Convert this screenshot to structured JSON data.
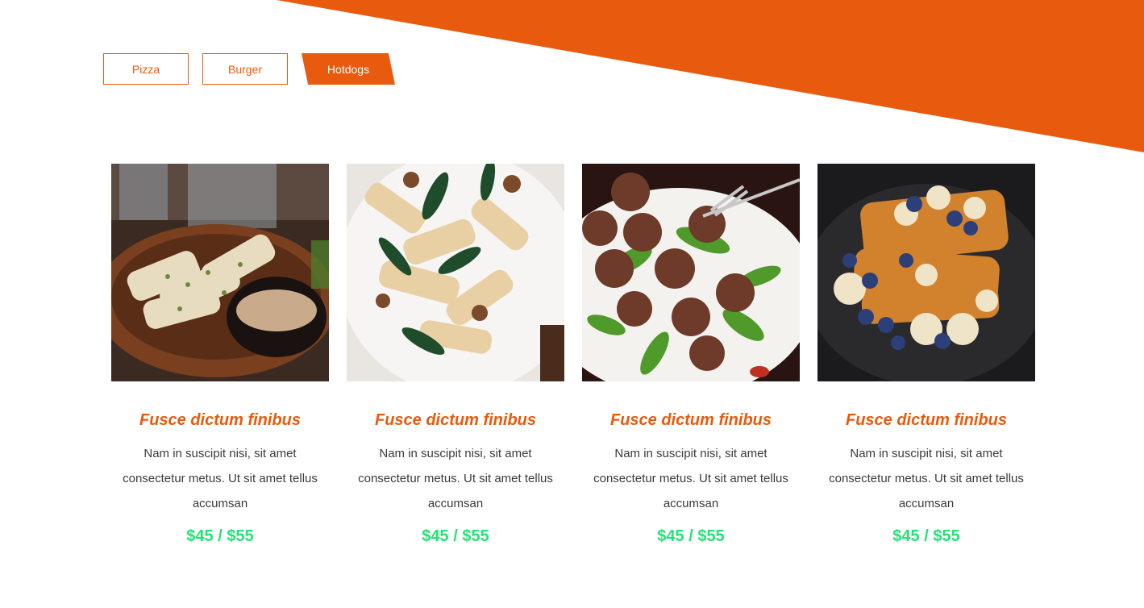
{
  "colors": {
    "accent": "#E85A0E",
    "price": "#22E374",
    "text": "#3b3b3b",
    "background": "#ffffff"
  },
  "tabs": [
    {
      "label": "Pizza",
      "active": false
    },
    {
      "label": "Burger",
      "active": false
    },
    {
      "label": "Hotdogs",
      "active": true
    }
  ],
  "items": [
    {
      "image": "food-photo-grilled-squid",
      "title": "Fusce dictum finibus",
      "description": "Nam in suscipit nisi, sit amet consectetur metus. Ut sit amet tellus accumsan",
      "price": "$45 / $55"
    },
    {
      "image": "food-photo-pasta",
      "title": "Fusce dictum finibus",
      "description": "Nam in suscipit nisi, sit amet consectetur metus. Ut sit amet tellus accumsan",
      "price": "$45 / $55"
    },
    {
      "image": "food-photo-meatballs",
      "title": "Fusce dictum finibus",
      "description": "Nam in suscipit nisi, sit amet consectetur metus. Ut sit amet tellus accumsan",
      "price": "$45 / $55"
    },
    {
      "image": "food-photo-french-toast",
      "title": "Fusce dictum finibus",
      "description": "Nam in suscipit nisi, sit amet consectetur metus. Ut sit amet tellus accumsan",
      "price": "$45 / $55"
    }
  ]
}
